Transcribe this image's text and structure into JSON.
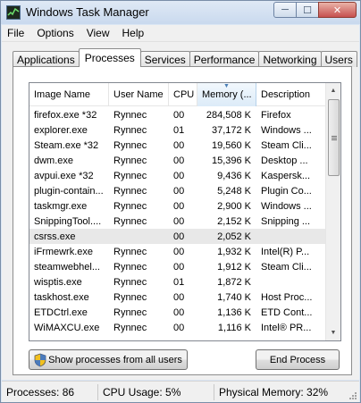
{
  "window": {
    "title": "Windows Task Manager",
    "minimize_glyph": "─",
    "maximize_glyph": "☐",
    "close_glyph": "✕"
  },
  "menu": [
    "File",
    "Options",
    "View",
    "Help"
  ],
  "tabs": [
    {
      "label": "Applications",
      "active": false
    },
    {
      "label": "Processes",
      "active": true
    },
    {
      "label": "Services",
      "active": false
    },
    {
      "label": "Performance",
      "active": false
    },
    {
      "label": "Networking",
      "active": false
    },
    {
      "label": "Users",
      "active": false
    }
  ],
  "processes": {
    "columns": [
      "Image Name",
      "User Name",
      "CPU",
      "Memory (...",
      "Description"
    ],
    "sorted_column": "Memory (...",
    "rows": [
      {
        "name": "firefox.exe *32",
        "user": "Rynnec",
        "cpu": "00",
        "memory": "284,508 K",
        "desc": "Firefox"
      },
      {
        "name": "explorer.exe",
        "user": "Rynnec",
        "cpu": "01",
        "memory": "37,172 K",
        "desc": "Windows ..."
      },
      {
        "name": "Steam.exe *32",
        "user": "Rynnec",
        "cpu": "00",
        "memory": "19,560 K",
        "desc": "Steam Cli..."
      },
      {
        "name": "dwm.exe",
        "user": "Rynnec",
        "cpu": "00",
        "memory": "15,396 K",
        "desc": "Desktop ..."
      },
      {
        "name": "avpui.exe *32",
        "user": "Rynnec",
        "cpu": "00",
        "memory": "9,436 K",
        "desc": "Kaspersk..."
      },
      {
        "name": "plugin-contain...",
        "user": "Rynnec",
        "cpu": "00",
        "memory": "5,248 K",
        "desc": "Plugin Co..."
      },
      {
        "name": "taskmgr.exe",
        "user": "Rynnec",
        "cpu": "00",
        "memory": "2,900 K",
        "desc": "Windows ..."
      },
      {
        "name": "SnippingTool....",
        "user": "Rynnec",
        "cpu": "00",
        "memory": "2,152 K",
        "desc": "Snipping ..."
      },
      {
        "name": "csrss.exe",
        "user": "",
        "cpu": "00",
        "memory": "2,052 K",
        "desc": ""
      },
      {
        "name": "iFrmewrk.exe",
        "user": "Rynnec",
        "cpu": "00",
        "memory": "1,932 K",
        "desc": "Intel(R) P..."
      },
      {
        "name": "steamwebhel...",
        "user": "Rynnec",
        "cpu": "00",
        "memory": "1,912 K",
        "desc": "Steam Cli..."
      },
      {
        "name": "wisptis.exe",
        "user": "Rynnec",
        "cpu": "01",
        "memory": "1,872 K",
        "desc": ""
      },
      {
        "name": "taskhost.exe",
        "user": "Rynnec",
        "cpu": "00",
        "memory": "1,740 K",
        "desc": "Host Proc..."
      },
      {
        "name": "ETDCtrl.exe",
        "user": "Rynnec",
        "cpu": "00",
        "memory": "1,136 K",
        "desc": "ETD Cont..."
      },
      {
        "name": "WiMAXCU.exe",
        "user": "Rynnec",
        "cpu": "00",
        "memory": "1,116 K",
        "desc": "Intel® PR..."
      }
    ],
    "selected_row": 8
  },
  "buttons": {
    "show_all": "Show processes from all users",
    "end_process": "End Process"
  },
  "status": {
    "processes": "Processes: 86",
    "cpu": "CPU Usage: 5%",
    "memory": "Physical Memory: 32%"
  }
}
